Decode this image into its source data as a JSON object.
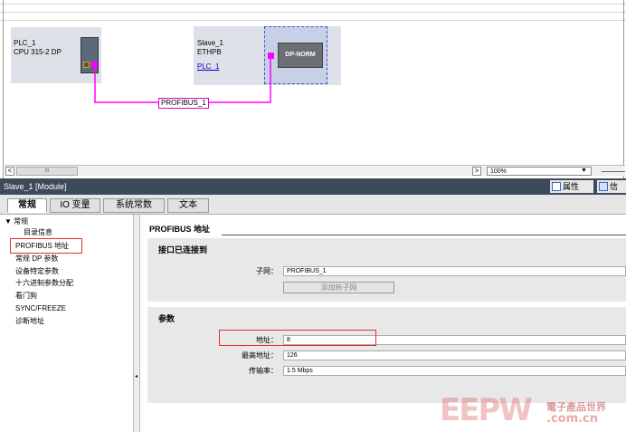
{
  "network_view": {
    "plc": {
      "name": "PLC_1",
      "type": "CPU 315-2 DP"
    },
    "slave": {
      "name": "Slave_1",
      "type": "ETHPB",
      "link": "PLC_1",
      "module_label": "DP-NORM"
    },
    "network_label": "PROFIBUS_1",
    "zoom": "100%",
    "scroll_marker": "III"
  },
  "inspector": {
    "title": "Slave_1 [Module]",
    "properties_label": "属性",
    "info_label": "信",
    "tabs": [
      "常规",
      "IO 变量",
      "系统常数",
      "文本"
    ]
  },
  "nav": {
    "items": [
      "▼ 常规",
      "目录信息",
      "PROFIBUS 地址",
      "常规 DP 参数",
      "设备特定参数",
      "十六进制参数分配",
      "看门狗",
      "SYNC/FREEZE",
      "诊断地址"
    ]
  },
  "content": {
    "heading": "PROFIBUS 地址",
    "interface_section": "接口已连接到",
    "subnet_label": "子网：",
    "subnet_value": "PROFIBUS_1",
    "add_subnet_button": "添加新子网",
    "params_section": "参数",
    "address_label": "地址：",
    "address_value": "8",
    "highest_label": "最高地址：",
    "highest_value": "126",
    "rate_label": "传输率：",
    "rate_value": "1.5 Mbps"
  },
  "watermark": {
    "logo": "EEPW",
    "cn": "電子產品世界",
    "url": ".com.cn"
  },
  "colors": {
    "accent_network": "#ff00ff",
    "title_bar": "#3d4a59",
    "highlight": "#e03030"
  }
}
